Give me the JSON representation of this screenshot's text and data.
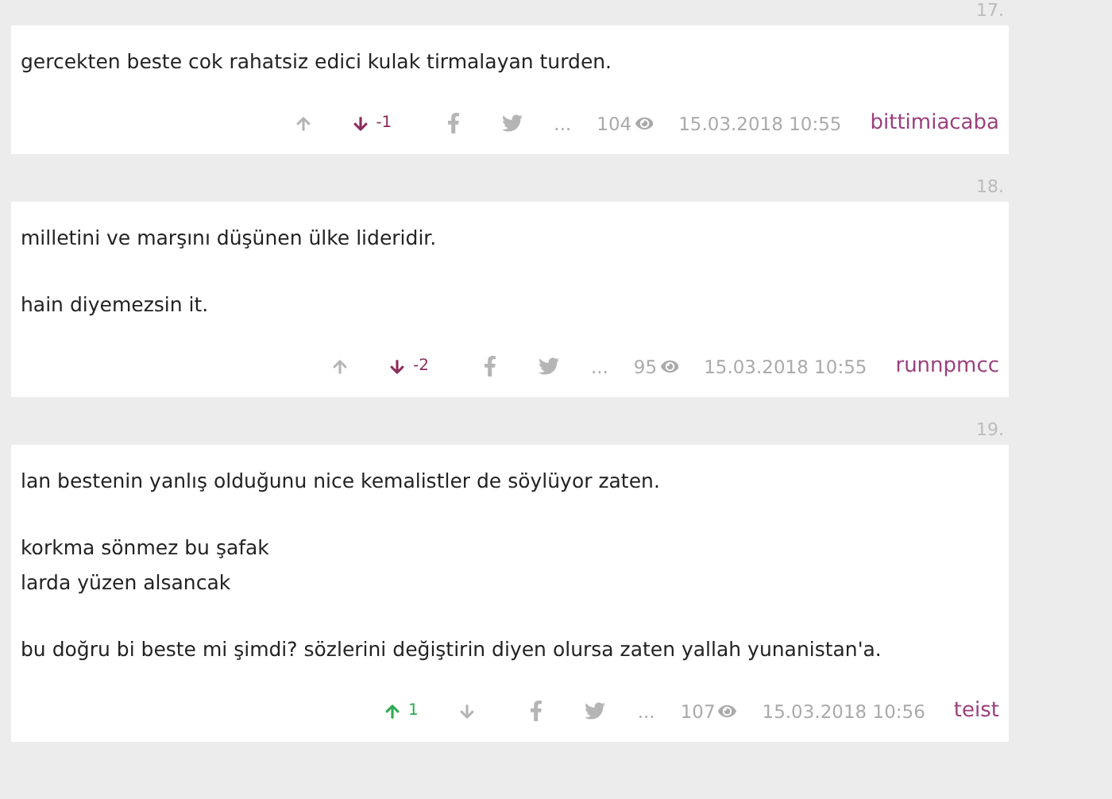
{
  "entries": [
    {
      "number": "17.",
      "paragraphs": [
        "gercekten beste cok rahatsiz edici kulak tirmalayan turden."
      ],
      "upvote": {
        "selected": false
      },
      "downvote": {
        "selected": true,
        "count": "-1"
      },
      "more": "...",
      "views": "104",
      "date": "15.03.2018 10:55",
      "author": "bittimiacaba"
    },
    {
      "number": "18.",
      "paragraphs": [
        "milletini ve marşını düşünen ülke lideridir.",
        "hain diyemezsin it."
      ],
      "upvote": {
        "selected": false
      },
      "downvote": {
        "selected": true,
        "count": "-2"
      },
      "more": "...",
      "views": "95",
      "date": "15.03.2018 10:55",
      "author": "runnpmcc"
    },
    {
      "number": "19.",
      "paragraphs": [
        "lan bestenin yanlış olduğunu nice kemalistler de söylüyor zaten.",
        "korkma sönmez bu şafak\nlarda yüzen alsancak",
        "bu doğru bi beste mi şimdi? sözlerini değiştirin diyen olursa zaten yallah yunanistan'a."
      ],
      "upvote": {
        "selected": true,
        "count": "1"
      },
      "downvote": {
        "selected": false
      },
      "more": "...",
      "views": "107",
      "date": "15.03.2018 10:56",
      "author": "teist"
    }
  ]
}
